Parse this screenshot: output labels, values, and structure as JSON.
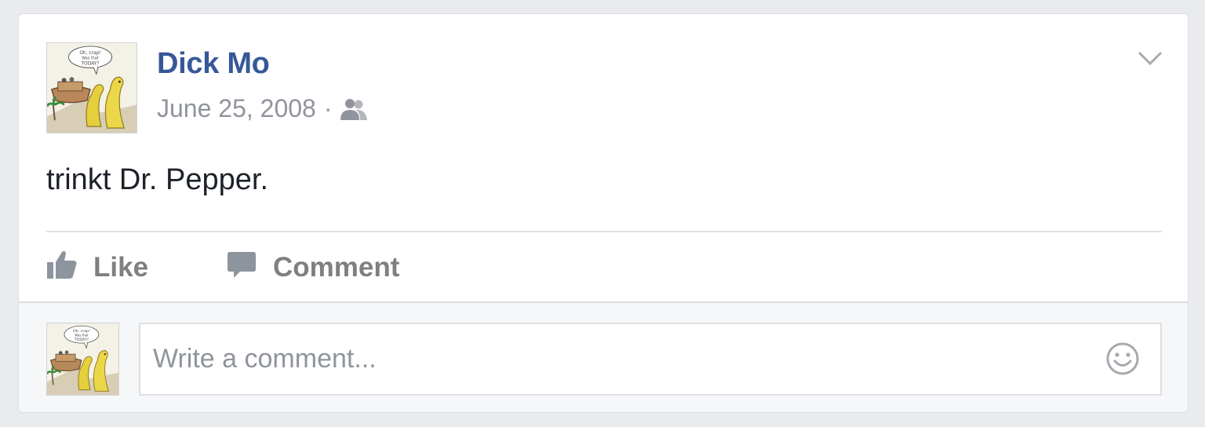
{
  "post": {
    "author": "Dick Mo",
    "date": "June 25, 2008",
    "separator": "·",
    "audience_icon": "friends-icon",
    "text": "trinkt Dr. Pepper.",
    "avatar_icon": "cartoon-dinosaurs-ark-avatar",
    "avatar_caption": "Oh, crap! Was that TODAY?",
    "menu_icon": "chevron-down-icon"
  },
  "actions": {
    "like_label": "Like",
    "like_icon": "thumbs-up-icon",
    "comment_label": "Comment",
    "comment_icon": "speech-bubble-icon"
  },
  "comment_box": {
    "placeholder": "Write a comment...",
    "value": "",
    "emoji_icon": "smiley-icon"
  },
  "colors": {
    "background": "#e9ebee",
    "author_link": "#365899",
    "meta_text": "#90949c",
    "body_text": "#1d2129",
    "action_text": "#7f7f7f"
  }
}
